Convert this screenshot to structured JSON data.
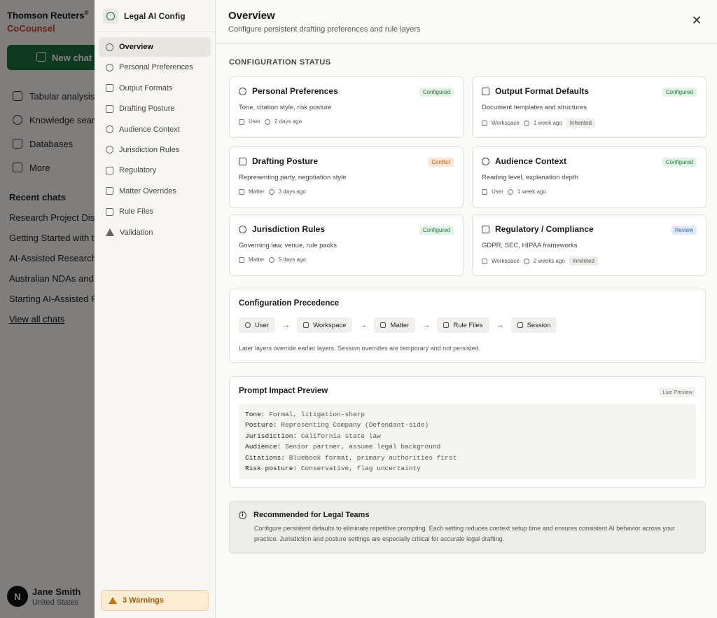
{
  "app": {
    "brand_line1": "Thomson Reuters",
    "brand_mark": "®",
    "brand_line2": "CoCounsel",
    "new_chat": "New chat",
    "nav": [
      "Tabular analysis",
      "Knowledge sear",
      "Databases",
      "More"
    ],
    "recent_heading": "Recent chats",
    "recent": [
      "Research Project Disc",
      "Getting Started with t",
      "AI-Assisted Research",
      "Australian NDAs and C",
      "Starting AI-Assisted F"
    ],
    "view_all": "View all chats",
    "user": {
      "initial": "N",
      "name": "Jane Smith",
      "country": "United States"
    }
  },
  "config_nav": {
    "title": "Legal AI Config",
    "items": [
      {
        "label": "Overview",
        "icon": "gear-icon"
      },
      {
        "label": "Personal Preferences",
        "icon": "user-icon"
      },
      {
        "label": "Output Formats",
        "icon": "document-icon"
      },
      {
        "label": "Drafting Posture",
        "icon": "scale-icon"
      },
      {
        "label": "Audience Context",
        "icon": "users-icon"
      },
      {
        "label": "Jurisdiction Rules",
        "icon": "globe-icon"
      },
      {
        "label": "Regulatory",
        "icon": "shield-icon"
      },
      {
        "label": "Matter Overrides",
        "icon": "briefcase-icon"
      },
      {
        "label": "Rule Files",
        "icon": "file-code-icon"
      },
      {
        "label": "Validation",
        "icon": "warning-icon"
      }
    ],
    "warnings": "3 Warnings"
  },
  "header": {
    "title": "Overview",
    "subtitle": "Configure persistent drafting preferences and rule layers",
    "close": "✕"
  },
  "status_heading": "CONFIGURATION STATUS",
  "cards": [
    {
      "title": "Personal Preferences",
      "icon": "user-icon",
      "badge": "Configured",
      "desc": "Tone, citation style, risk posture",
      "scope": "User",
      "time": "2 days ago",
      "inherited": ""
    },
    {
      "title": "Output Format Defaults",
      "icon": "document-icon",
      "badge": "Configured",
      "desc": "Document templates and structures",
      "scope": "Workspace",
      "time": "1 week ago",
      "inherited": "Inherited"
    },
    {
      "title": "Drafting Posture",
      "icon": "scale-icon",
      "badge": "Conflict",
      "desc": "Representing party, negotiation style",
      "scope": "Matter",
      "time": "3 days ago",
      "inherited": ""
    },
    {
      "title": "Audience Context",
      "icon": "users-icon",
      "badge": "Configured",
      "desc": "Reading level, explanation depth",
      "scope": "User",
      "time": "1 week ago",
      "inherited": ""
    },
    {
      "title": "Jurisdiction Rules",
      "icon": "globe-icon",
      "badge": "Configured",
      "desc": "Governing law, venue, rule packs",
      "scope": "Matter",
      "time": "5 days ago",
      "inherited": ""
    },
    {
      "title": "Regulatory / Compliance",
      "icon": "shield-icon",
      "badge": "Review",
      "desc": "GDPR, SEC, HIPAA frameworks",
      "scope": "Workspace",
      "time": "2 weeks ago",
      "inherited": "Inherited"
    }
  ],
  "precedence": {
    "title": "Configuration Precedence",
    "chain": [
      "User",
      "Workspace",
      "Matter",
      "Rule Files",
      "Session"
    ],
    "note": "Later layers override earlier layers. Session overrides are temporary and not persisted."
  },
  "impact": {
    "title": "Prompt Impact Preview",
    "badge": "Live Preview",
    "lines": [
      {
        "key": "Tone:",
        "value": "Formal, litigation-sharp"
      },
      {
        "key": "Posture:",
        "value": "Representing Company (Defendant-side)"
      },
      {
        "key": "Jurisdiction:",
        "value": "California state law"
      },
      {
        "key": "Audience:",
        "value": "Senior partner, assume legal background"
      },
      {
        "key": "Citations:",
        "value": "Bluebook format, primary authorities first"
      },
      {
        "key": "Risk posture:",
        "value": "Conservative, flag uncertainty"
      }
    ]
  },
  "recommendation": {
    "title": "Recommended for Legal Teams",
    "body": "Configure persistent defaults to eliminate repetitive prompting. Each setting reduces context setup time and ensures consistent AI behavior across your practice. Jurisdiction and posture settings are especially critical for accurate legal drafting."
  }
}
